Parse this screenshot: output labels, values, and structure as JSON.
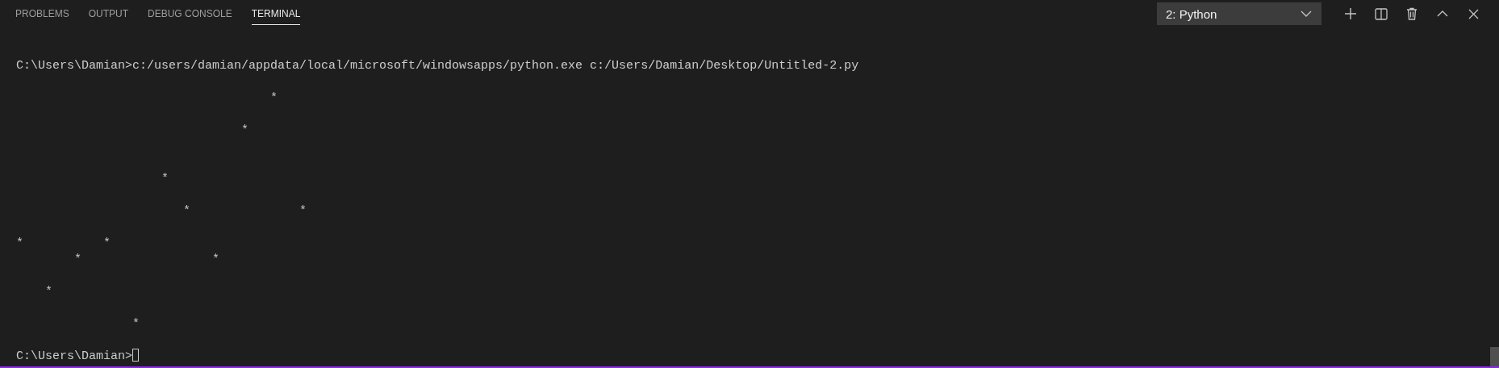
{
  "tabs": [
    {
      "label": "PROBLEMS",
      "selected": false
    },
    {
      "label": "OUTPUT",
      "selected": false
    },
    {
      "label": "DEBUG CONSOLE",
      "selected": false
    },
    {
      "label": "TERMINAL",
      "selected": true
    }
  ],
  "terminal_selector": {
    "value": "2: Python"
  },
  "terminal": {
    "lines": [
      {
        "kind": "command",
        "text": "C:\\Users\\Damian>c:/users/damian/appdata/local/microsoft/windowsapps/python.exe c:/Users/Damian/Desktop/Untitled-2.py"
      },
      {
        "kind": "blank"
      },
      {
        "kind": "output",
        "text": "                                   *"
      },
      {
        "kind": "blank"
      },
      {
        "kind": "output",
        "text": "                               *"
      },
      {
        "kind": "blank"
      },
      {
        "kind": "blank"
      },
      {
        "kind": "output",
        "text": "                    *"
      },
      {
        "kind": "blank"
      },
      {
        "kind": "output",
        "text": "                       *               *"
      },
      {
        "kind": "blank"
      },
      {
        "kind": "output",
        "text": "*           *"
      },
      {
        "kind": "output",
        "text": "        *                  *"
      },
      {
        "kind": "blank"
      },
      {
        "kind": "output",
        "text": "    *"
      },
      {
        "kind": "blank"
      },
      {
        "kind": "output",
        "text": "                *"
      },
      {
        "kind": "blank"
      },
      {
        "kind": "prompt",
        "text": "C:\\Users\\Damian>"
      }
    ]
  }
}
